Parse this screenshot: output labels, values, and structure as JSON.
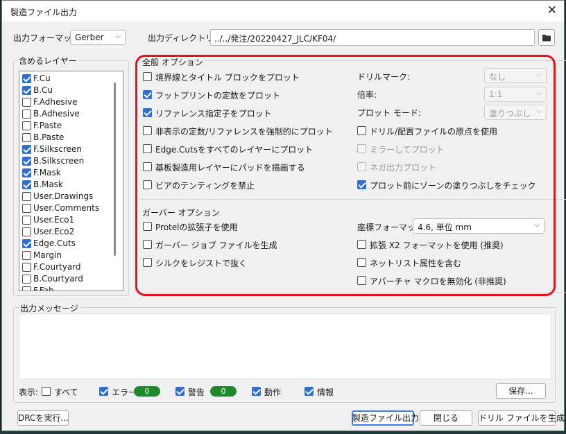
{
  "dialog": {
    "title": "製造ファイル出力",
    "close_glyph": "✕"
  },
  "top": {
    "format_label": "出力フォーマット:",
    "format_value": "Gerber",
    "dir_label": "出力ディレクトリー:",
    "dir_value": "../../発注/20220427_JLC/KF04/",
    "folder_icon": "folder-icon"
  },
  "layers": {
    "title": "含めるレイヤー",
    "items": [
      {
        "label": "F.Cu",
        "checked": true
      },
      {
        "label": "B.Cu",
        "checked": true
      },
      {
        "label": "F.Adhesive",
        "checked": false
      },
      {
        "label": "B.Adhesive",
        "checked": false
      },
      {
        "label": "F.Paste",
        "checked": false
      },
      {
        "label": "B.Paste",
        "checked": false
      },
      {
        "label": "F.Silkscreen",
        "checked": true
      },
      {
        "label": "B.Silkscreen",
        "checked": true
      },
      {
        "label": "F.Mask",
        "checked": true
      },
      {
        "label": "B.Mask",
        "checked": true
      },
      {
        "label": "User.Drawings",
        "checked": false
      },
      {
        "label": "User.Comments",
        "checked": false
      },
      {
        "label": "User.Eco1",
        "checked": false
      },
      {
        "label": "User.Eco2",
        "checked": false
      },
      {
        "label": "Edge.Cuts",
        "checked": true
      },
      {
        "label": "Margin",
        "checked": false
      },
      {
        "label": "F.Courtyard",
        "checked": false
      },
      {
        "label": "B.Courtyard",
        "checked": false
      },
      {
        "label": "F.Fab",
        "checked": false
      }
    ]
  },
  "general": {
    "title": "全般 オプション",
    "left": [
      {
        "label": "境界線とタイトル ブロックをプロット",
        "checked": false
      },
      {
        "label": "フットプリントの定数をプロット",
        "checked": true
      },
      {
        "label": "リファレンス指定子をプロット",
        "checked": true
      },
      {
        "label": "非表示の定数/リファレンスを強制的にプロット",
        "checked": false
      },
      {
        "label": "Edge.Cutsをすべてのレイヤーにプロット",
        "checked": false
      },
      {
        "label": "基板製造用レイヤーにパッドを描画する",
        "checked": false
      },
      {
        "label": "ビアのテンティングを禁止",
        "checked": false
      }
    ],
    "drill_mark_label": "ドリルマーク:",
    "drill_mark_value": "なし",
    "scale_label": "倍率:",
    "scale_value": "1:1",
    "plot_mode_label": "プロット モード:",
    "plot_mode_value": "塗りつぶし",
    "right": [
      {
        "label": "ドリル/配置ファイルの原点を使用",
        "checked": false,
        "disabled": false
      },
      {
        "label": "ミラーしてプロット",
        "checked": false,
        "disabled": true
      },
      {
        "label": "ネガ出力プロット",
        "checked": false,
        "disabled": true
      },
      {
        "label": "プロット前にゾーンの塗りつぶしをチェック",
        "checked": true,
        "disabled": false
      }
    ]
  },
  "gerber": {
    "title": "ガーバー オプション",
    "left": [
      {
        "label": "Protelの拡張子を使用",
        "checked": false
      },
      {
        "label": "ガーバー ジョブ ファイルを生成",
        "checked": false
      },
      {
        "label": "シルクをレジストで抜く",
        "checked": false
      }
    ],
    "coord_label": "座標フォーマット:",
    "coord_value": "4.6, 単位 mm",
    "right": [
      {
        "label": "拡張 X2 フォーマットを使用 (推奨)",
        "checked": false
      },
      {
        "label": "ネットリスト属性を含む",
        "checked": false
      },
      {
        "label": "アパーチャ マクロを無効化 (非推奨)",
        "checked": false
      }
    ]
  },
  "messages": {
    "title": "出力メッセージ",
    "show_label": "表示:",
    "filters": [
      {
        "label": "すべて",
        "checked": false
      },
      {
        "label": "エラー",
        "checked": true,
        "count": "0"
      },
      {
        "label": "警告",
        "checked": true,
        "count": "0"
      },
      {
        "label": "動作",
        "checked": true
      },
      {
        "label": "情報",
        "checked": true
      }
    ],
    "save_label": "保存..."
  },
  "buttons": {
    "drc": "DRCを実行...",
    "plot": "製造ファイル出力",
    "close": "閉じる",
    "drill": "ドリル ファイルを生成..."
  },
  "colors": {
    "accent": "#2f6fd0",
    "highlight": "#e0141e",
    "badge": "#1f8a2a"
  }
}
